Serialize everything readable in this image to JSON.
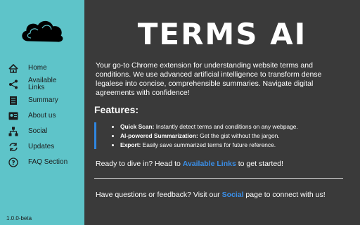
{
  "sidebar": {
    "items": [
      {
        "label": "Home",
        "icon": "home-icon"
      },
      {
        "label": "Available\nLinks",
        "icon": "share-icon"
      },
      {
        "label": "Summary",
        "icon": "summary-icon"
      },
      {
        "label": "About us",
        "icon": "about-icon"
      },
      {
        "label": "Social",
        "icon": "social-icon"
      },
      {
        "label": "Updates",
        "icon": "refresh-icon"
      },
      {
        "label": "FAQ Section",
        "icon": "question-icon"
      }
    ],
    "version": "1.0.0-beta"
  },
  "main": {
    "title": "TERMS AI",
    "intro": "Your go-to Chrome extension for understanding website terms and conditions. We use advanced artificial intelligence to transform dense legalese into concise, comprehensible summaries. Navigate digital agreements with confidence!",
    "features_heading": "Features:",
    "features": [
      {
        "name": "Quick Scan:",
        "text": " Instantly detect terms and conditions on any webpage."
      },
      {
        "name": "AI-powered Summarization:",
        "text": " Get the gist without the jargon."
      },
      {
        "name": "Export:",
        "text": " Easily save summarized terms for future reference."
      }
    ],
    "cta_before": "Ready to dive in? Head to ",
    "cta_link": "Available Links",
    "cta_after": " to get started!",
    "contact_before": "Have questions or feedback? Visit our ",
    "contact_link": "Social",
    "contact_after": " page to connect with us!"
  },
  "colors": {
    "sidebar_bg": "#5ec4c9",
    "main_bg": "#3a3a3a",
    "accent": "#3a8fe8",
    "feature_bar": "#2f86e0"
  }
}
